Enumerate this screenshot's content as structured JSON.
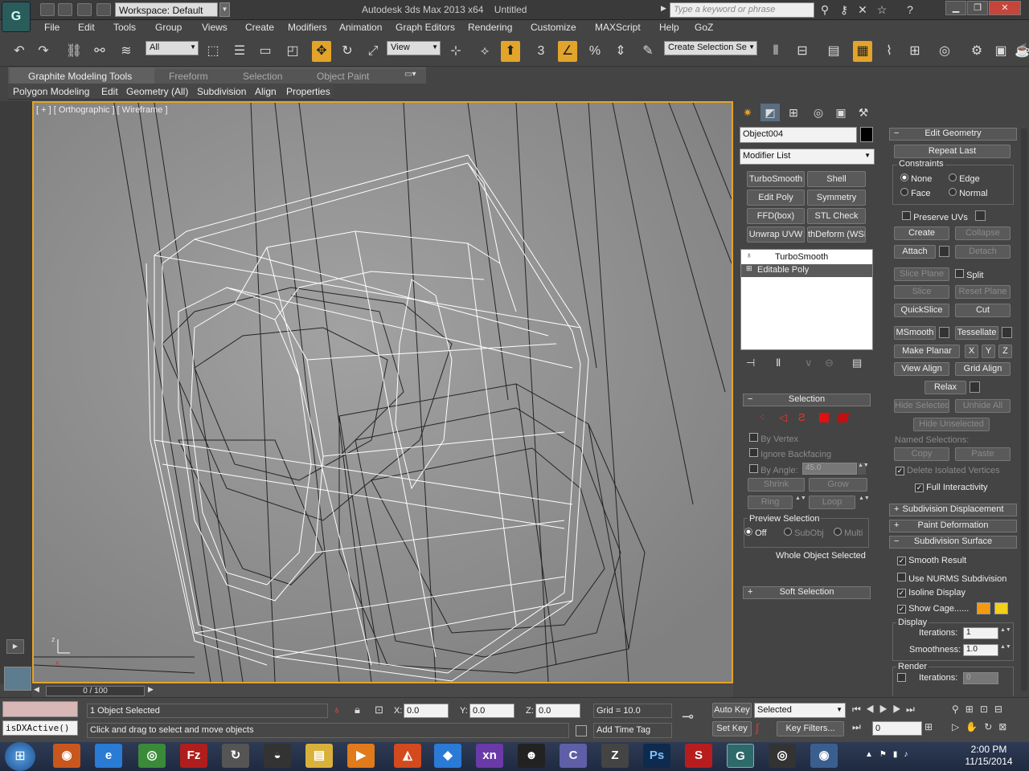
{
  "titlebar": {
    "app_logo": "G",
    "workspace": "Workspace: Default",
    "app_name": "Autodesk 3ds Max  2013 x64",
    "doc_name": "Untitled",
    "search_placeholder": "Type a keyword or phrase"
  },
  "menu": [
    "File",
    "Edit",
    "Tools",
    "Group",
    "Views",
    "Create",
    "Modifiers",
    "Animation",
    "Graph Editors",
    "Rendering",
    "Customize",
    "MAXScript",
    "Help",
    "GoZ"
  ],
  "toolbar": {
    "selection_filter": "All",
    "ref_coord": "View",
    "snap_count": "3",
    "named_selection": "Create Selection Se"
  },
  "ribbon": {
    "tabs": [
      "Graphite Modeling Tools",
      "Freeform",
      "Selection",
      "Object Paint"
    ],
    "sub_items": [
      "Polygon Modeling",
      "Edit",
      "Geometry (All)",
      "Subdivision",
      "Align",
      "Properties"
    ]
  },
  "viewport": {
    "label": "[ + ] [ Orthographic ] [ Wireframe ]"
  },
  "timeslider": {
    "frame": "0 / 100"
  },
  "command_panel": {
    "object_name": "Object004",
    "modifier_list": "Modifier List",
    "modifier_buttons": [
      "TurboSmooth",
      "Shell",
      "Edit Poly",
      "Symmetry",
      "FFD(box)",
      "STL Check",
      "Unwrap UVW",
      "thDeform (WSI"
    ],
    "stack": [
      "TurboSmooth",
      "Editable Poly"
    ],
    "selection": {
      "title": "Selection",
      "by_vertex": "By Vertex",
      "ignore_backfacing": "Ignore Backfacing",
      "by_angle": "By Angle:",
      "angle_value": "45.0",
      "shrink": "Shrink",
      "grow": "Grow",
      "ring": "Ring",
      "loop": "Loop",
      "preview_selection": "Preview Selection",
      "off": "Off",
      "subobj": "SubObj",
      "multi": "Multi",
      "status": "Whole Object Selected"
    },
    "soft_selection": "Soft Selection",
    "edit_geometry": {
      "title": "Edit Geometry",
      "repeat_last": "Repeat Last",
      "constraints": "Constraints",
      "none": "None",
      "edge": "Edge",
      "face": "Face",
      "normal": "Normal",
      "preserve_uvs": "Preserve UVs",
      "create": "Create",
      "collapse": "Collapse",
      "attach": "Attach",
      "detach": "Detach",
      "slice_plane": "Slice Plane",
      "split": "Split",
      "slice": "Slice",
      "reset_plane": "Reset Plane",
      "quickslice": "QuickSlice",
      "cut": "Cut",
      "msmooth": "MSmooth",
      "tessellate": "Tessellate",
      "make_planar": "Make Planar",
      "x": "X",
      "y": "Y",
      "z": "Z",
      "view_align": "View Align",
      "grid_align": "Grid Align",
      "relax": "Relax",
      "hide_selected": "Hide Selected",
      "unhide_all": "Unhide All",
      "hide_unselected": "Hide Unselected",
      "named_selections": "Named Selections:",
      "copy": "Copy",
      "paste": "Paste",
      "delete_isolated": "Delete Isolated Vertices",
      "full_interactivity": "Full Interactivity"
    },
    "rollouts": [
      "Subdivision Displacement",
      "Paint Deformation"
    ],
    "subdivision_surface": {
      "title": "Subdivision Surface",
      "smooth_result": "Smooth Result",
      "use_nurms": "Use NURMS Subdivision",
      "isoline_display": "Isoline Display",
      "show_cage": "Show Cage......",
      "cage_color1": "#f39a12",
      "cage_color2": "#f2d01b",
      "display": "Display",
      "iterations_label": "Iterations:",
      "iterations": "1",
      "smoothness_label": "Smoothness:",
      "smoothness": "1.0",
      "render": "Render",
      "render_iterations": "0"
    }
  },
  "status": {
    "maxscript": "isDXActive()",
    "selected": "1 Object Selected",
    "prompt": "Click and drag to select and move objects",
    "x": "0.0",
    "y": "0.0",
    "z": "0.0",
    "grid": "Grid = 10.0",
    "add_time_tag": "Add Time Tag",
    "auto_key": "Auto Key",
    "set_key": "Set Key",
    "selected_drop": "Selected",
    "key_filters": "Key Filters...",
    "frame_field": "0"
  },
  "taskbar": {
    "time": "2:00 PM",
    "date": "11/15/2014"
  },
  "colors": {
    "accent": "#e3a42a",
    "viewport_bg": "#939393",
    "object_color": "#000000"
  }
}
